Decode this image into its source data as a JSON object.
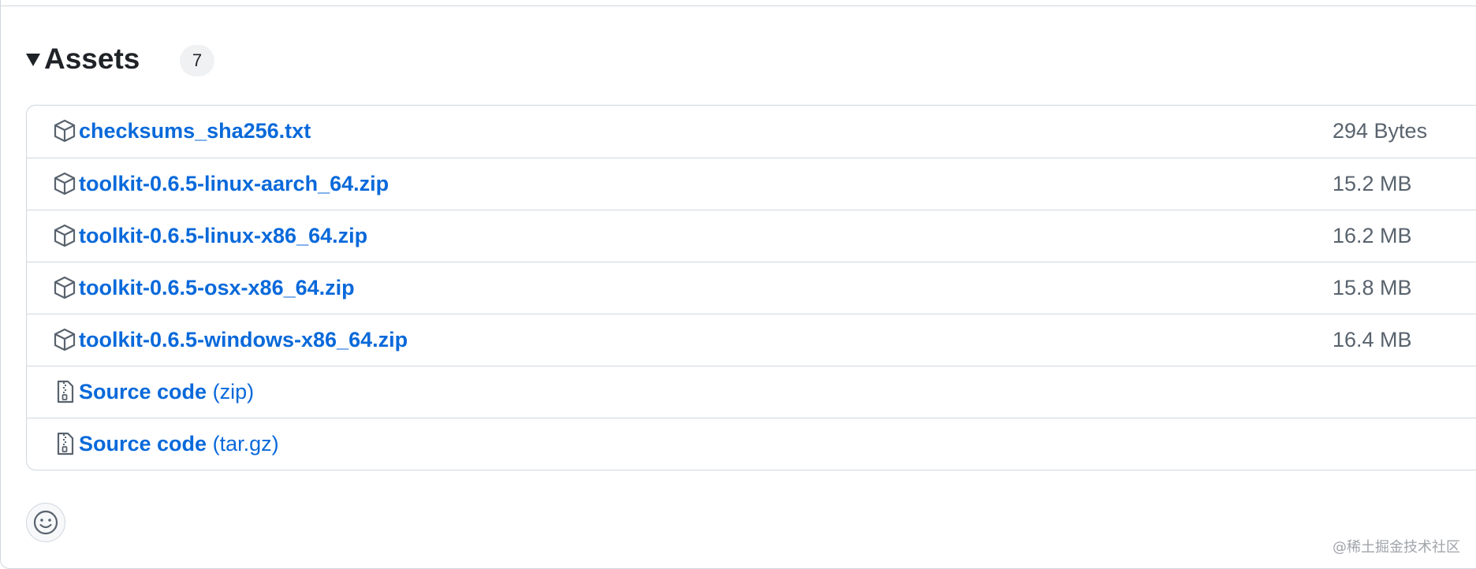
{
  "assets": {
    "title": "Assets",
    "count": "7",
    "items": [
      {
        "name": "checksums_sha256.txt",
        "suffix": "",
        "size": "294 Bytes",
        "icon": "package-icon"
      },
      {
        "name": "toolkit-0.6.5-linux-aarch_64.zip",
        "suffix": "",
        "size": "15.2 MB",
        "icon": "package-icon"
      },
      {
        "name": "toolkit-0.6.5-linux-x86_64.zip",
        "suffix": "",
        "size": "16.2 MB",
        "icon": "package-icon"
      },
      {
        "name": "toolkit-0.6.5-osx-x86_64.zip",
        "suffix": "",
        "size": "15.8 MB",
        "icon": "package-icon"
      },
      {
        "name": "toolkit-0.6.5-windows-x86_64.zip",
        "suffix": "",
        "size": "16.4 MB",
        "icon": "package-icon"
      },
      {
        "name": "Source code",
        "suffix": "(zip)",
        "size": "",
        "icon": "file-zip-icon"
      },
      {
        "name": "Source code",
        "suffix": "(tar.gz)",
        "size": "",
        "icon": "file-zip-icon"
      }
    ]
  },
  "reactions": {
    "icon": "smiley-icon"
  },
  "watermark": "@稀土掘金技术社区",
  "colors": {
    "link": "#0969da",
    "border": "#d0d7de",
    "text": "#1f2328",
    "muted": "#59636e"
  }
}
